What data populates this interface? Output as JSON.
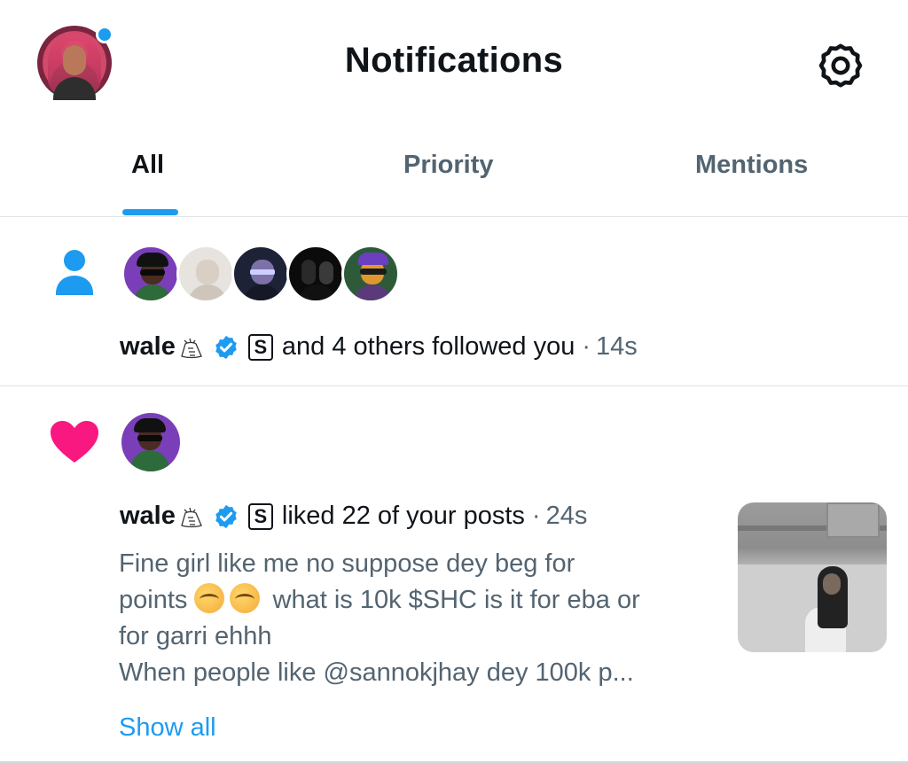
{
  "header": {
    "title": "Notifications",
    "avatar_icon": "user-avatar",
    "settings_icon": "gear-icon",
    "accent_color": "#1d9bf0"
  },
  "tabs": [
    {
      "label": "All",
      "active": true
    },
    {
      "label": "Priority",
      "active": false
    },
    {
      "label": "Mentions",
      "active": false
    }
  ],
  "notifications": [
    {
      "type": "follow",
      "icon": "person-icon",
      "avatar_count": 5,
      "username": "wale",
      "action": "and 4 others followed you",
      "separator": "·",
      "time": "14s"
    },
    {
      "type": "like",
      "icon": "heart-icon",
      "username": "wale",
      "action": "liked 22 of your posts",
      "separator": "·",
      "time": "24s",
      "post_lines": [
        "Fine girl like me no suppose dey beg for",
        "points",
        "what is 10k $SHC is it for eba or",
        "for garri ehhh",
        "When people like @sannokjhay  dey 100k p..."
      ],
      "emoji": "sneezing-face-emoji",
      "show_all": "Show all"
    }
  ],
  "badge_letter": "S"
}
